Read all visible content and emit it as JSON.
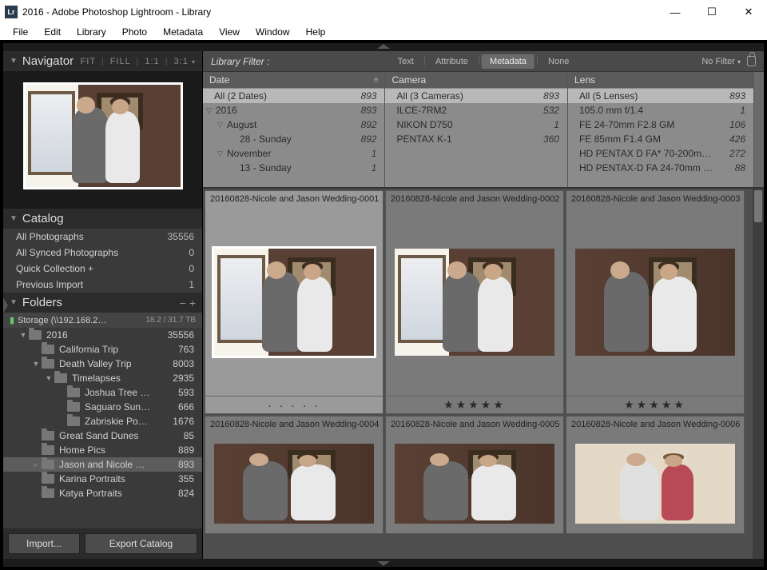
{
  "titlebar": {
    "icon": "Lr",
    "text": "2016 - Adobe Photoshop Lightroom - Library"
  },
  "menu": [
    "File",
    "Edit",
    "Library",
    "Photo",
    "Metadata",
    "View",
    "Window",
    "Help"
  ],
  "navigator": {
    "title": "Navigator",
    "opts": [
      "FIT",
      "FILL",
      "1:1",
      "3:1"
    ]
  },
  "catalog": {
    "title": "Catalog",
    "rows": [
      {
        "label": "All Photographs",
        "count": "35556"
      },
      {
        "label": "All Synced Photographs",
        "count": "0"
      },
      {
        "label": "Quick Collection  +",
        "count": "0"
      },
      {
        "label": "Previous Import",
        "count": "1"
      }
    ]
  },
  "folders": {
    "title": "Folders",
    "storage": {
      "name": "Storage (\\\\192.168.2…",
      "cap": "18.2 / 31.7 TB"
    },
    "tree": [
      {
        "ind": 1,
        "disc": "▼",
        "label": "2016",
        "count": "35556"
      },
      {
        "ind": 2,
        "disc": "",
        "label": "California Trip",
        "count": "763"
      },
      {
        "ind": 2,
        "disc": "▼",
        "label": "Death Valley Trip",
        "count": "8003"
      },
      {
        "ind": 3,
        "disc": "▼",
        "label": "Timelapses",
        "count": "2935"
      },
      {
        "ind": 4,
        "disc": "",
        "label": "Joshua Tree …",
        "count": "593"
      },
      {
        "ind": 4,
        "disc": "",
        "label": "Saguaro Sun…",
        "count": "666"
      },
      {
        "ind": 4,
        "disc": "",
        "label": "Zabriskie Po…",
        "count": "1676"
      },
      {
        "ind": 2,
        "disc": "",
        "label": "Great Sand Dunes",
        "count": "85"
      },
      {
        "ind": 2,
        "disc": "",
        "label": "Home Pics",
        "count": "889"
      },
      {
        "ind": 2,
        "disc": "▹",
        "label": "Jason and Nicole …",
        "count": "893",
        "sel": true
      },
      {
        "ind": 2,
        "disc": "",
        "label": "Karina Portraits",
        "count": "355"
      },
      {
        "ind": 2,
        "disc": "",
        "label": "Katya Portraits",
        "count": "824"
      }
    ]
  },
  "buttons": {
    "import": "Import...",
    "export": "Export Catalog"
  },
  "filter": {
    "label": "Library Filter :",
    "tabs": [
      "Text",
      "Attribute",
      "Metadata",
      "None"
    ],
    "active": "Metadata",
    "nofilter": "No Filter"
  },
  "meta": {
    "date": {
      "title": "Date",
      "rows": [
        {
          "ind": 0,
          "disc": "",
          "label": "All (2 Dates)",
          "count": "893",
          "all": true
        },
        {
          "ind": 0,
          "disc": "▽",
          "label": "2016",
          "count": "893"
        },
        {
          "ind": 1,
          "disc": "▽",
          "label": "August",
          "count": "892"
        },
        {
          "ind": 2,
          "disc": "",
          "label": "28 - Sunday",
          "count": "892"
        },
        {
          "ind": 1,
          "disc": "▽",
          "label": "November",
          "count": "1"
        },
        {
          "ind": 2,
          "disc": "",
          "label": "13 - Sunday",
          "count": "1"
        }
      ]
    },
    "camera": {
      "title": "Camera",
      "rows": [
        {
          "ind": 0,
          "label": "All (3 Cameras)",
          "count": "893",
          "all": true
        },
        {
          "ind": 0,
          "label": "ILCE-7RM2",
          "count": "532"
        },
        {
          "ind": 0,
          "label": "NIKON D750",
          "count": "1"
        },
        {
          "ind": 0,
          "label": "PENTAX K-1",
          "count": "360"
        }
      ]
    },
    "lens": {
      "title": "Lens",
      "rows": [
        {
          "ind": 0,
          "label": "All (5 Lenses)",
          "count": "893",
          "all": true
        },
        {
          "ind": 0,
          "label": "105.0 mm f/1.4",
          "count": "1"
        },
        {
          "ind": 0,
          "label": "FE 24-70mm F2.8 GM",
          "count": "106"
        },
        {
          "ind": 0,
          "label": "FE 85mm F1.4 GM",
          "count": "426"
        },
        {
          "ind": 0,
          "label": "HD PENTAX D FA* 70-200m…",
          "count": "272"
        },
        {
          "ind": 0,
          "label": "HD PENTAX-D FA 24-70mm …",
          "count": "88"
        }
      ]
    }
  },
  "thumbs": [
    {
      "cap": "20160828-Nicole and Jason Wedding-0001",
      "sel": true,
      "stars": "·   ·   ·   ·   ·",
      "variant": "A"
    },
    {
      "cap": "20160828-Nicole and Jason Wedding-0002",
      "stars": "★★★★★",
      "variant": "A"
    },
    {
      "cap": "20160828-Nicole and Jason Wedding-0003",
      "stars": "★★★★★",
      "variant": "B"
    },
    {
      "cap": "20160828-Nicole and Jason Wedding-0004",
      "variant": "B"
    },
    {
      "cap": "20160828-Nicole and Jason Wedding-0005",
      "variant": "B"
    },
    {
      "cap": "20160828-Nicole and Jason Wedding-0006",
      "variant": "C"
    }
  ]
}
